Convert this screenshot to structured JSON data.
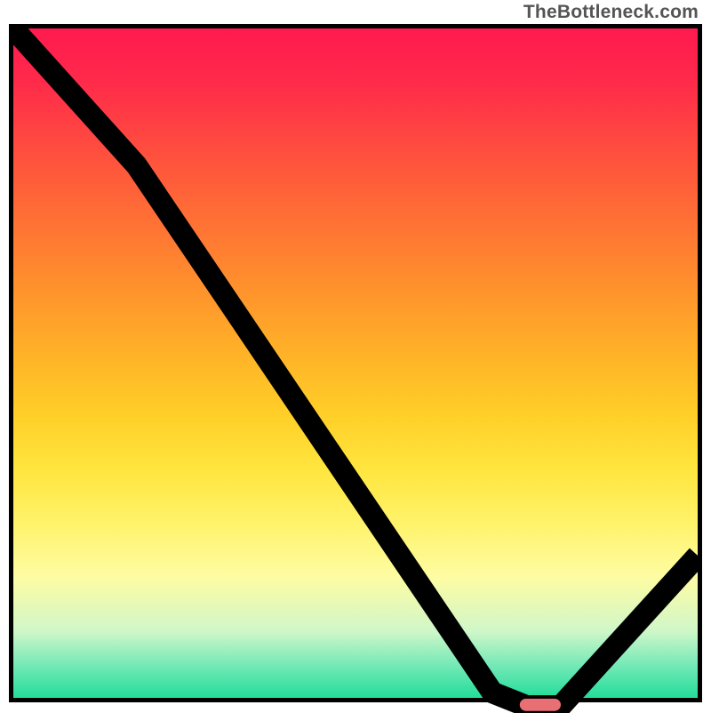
{
  "watermark": "TheBottleneck.com",
  "chart_data": {
    "type": "line",
    "title": "",
    "xlabel": "",
    "ylabel": "",
    "xlim": [
      0,
      100
    ],
    "ylim": [
      0,
      100
    ],
    "grid": false,
    "series": [
      {
        "name": "bottleneck-curve",
        "x": [
          0,
          18,
          70,
          75,
          80,
          100
        ],
        "values": [
          100,
          80,
          3,
          1,
          1,
          23
        ]
      }
    ],
    "marker": {
      "x_start": 74,
      "x_end": 80,
      "y": 1.2,
      "color": "#e86f74"
    },
    "background": {
      "type": "vertical-gradient",
      "stops": [
        {
          "pos": 0,
          "color": "#ff1a4f"
        },
        {
          "pos": 50,
          "color": "#ffc028"
        },
        {
          "pos": 80,
          "color": "#fcfca0"
        },
        {
          "pos": 100,
          "color": "#22dd99"
        }
      ]
    }
  }
}
